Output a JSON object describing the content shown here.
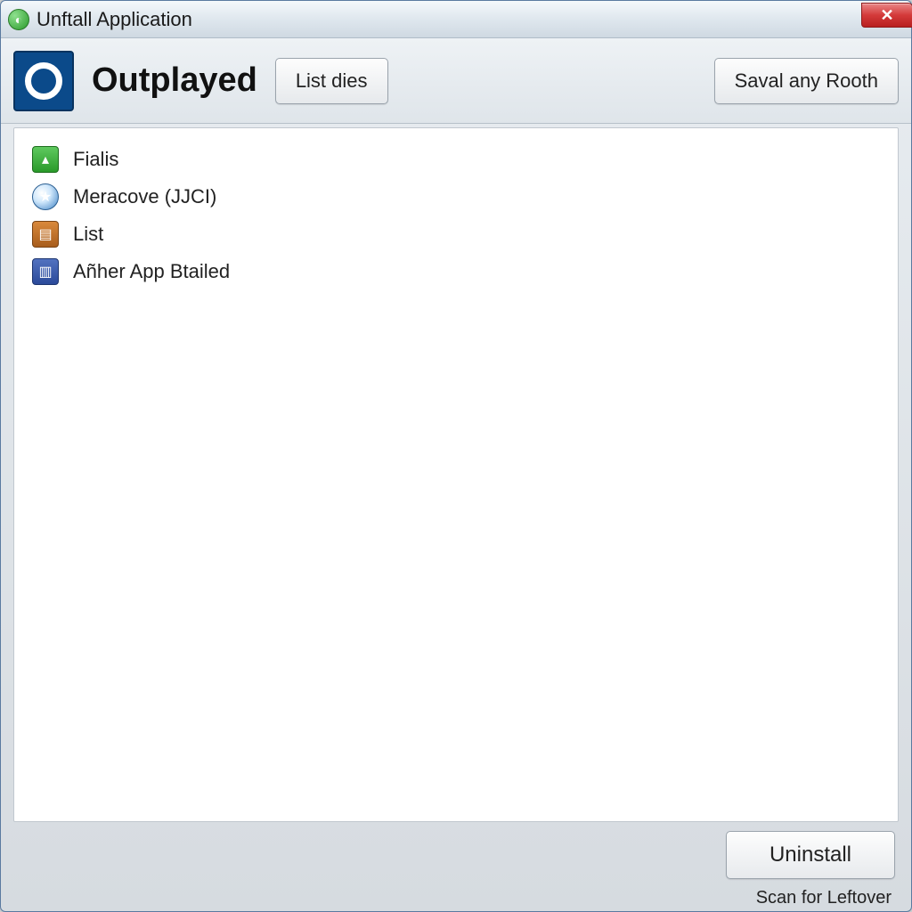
{
  "window": {
    "title": "Unftall Application"
  },
  "toolbar": {
    "app_name": "Outplayed",
    "list_dies_label": "List dies",
    "saval_label": "Saval any Rooth"
  },
  "items": [
    {
      "label": "Fialis",
      "icon_class": "ic-green"
    },
    {
      "label": "Meracove (JJCI)",
      "icon_class": "ic-blue"
    },
    {
      "label": "List",
      "icon_class": "ic-orange"
    },
    {
      "label": "Añher App Btailed",
      "icon_class": "ic-dblue"
    }
  ],
  "footer": {
    "uninstall_label": "Uninstall",
    "scan_label": "Scan for Leftover"
  }
}
